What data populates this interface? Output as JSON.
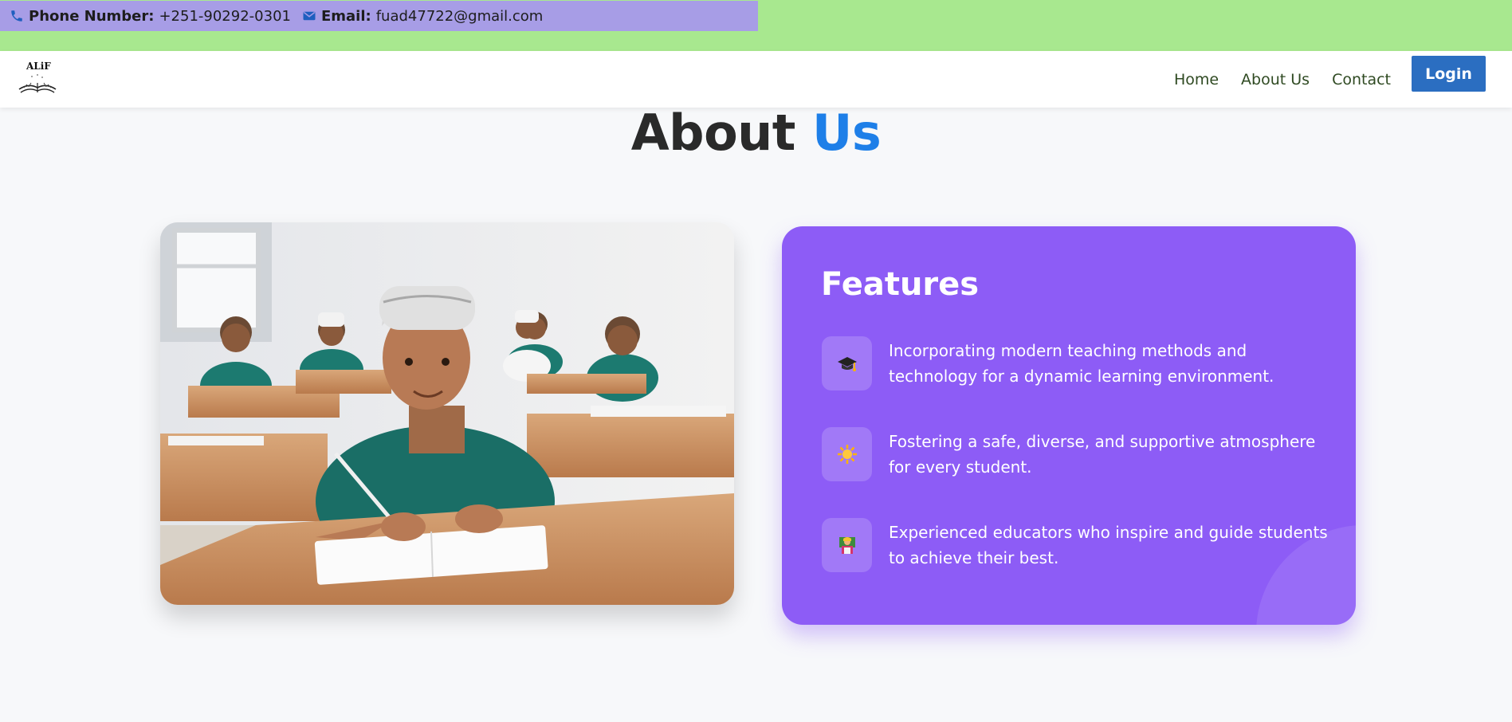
{
  "contact": {
    "phone_label": "Phone Number:",
    "phone_value": "+251-90292-0301",
    "email_label": "Email:",
    "email_value": "fuad47722@gmail.com",
    "phone_icon": "phone-icon",
    "email_icon": "envelope-icon"
  },
  "brand": {
    "logo_text": "ALiF"
  },
  "nav": {
    "items": [
      {
        "label": "Home"
      },
      {
        "label": "About Us"
      },
      {
        "label": "Contact"
      }
    ],
    "login_label": "Login"
  },
  "about": {
    "heading_main": "About",
    "heading_accent": "Us"
  },
  "features": {
    "title": "Features",
    "items": [
      {
        "icon": "graduation-cap-icon",
        "text": "Incorporating modern teaching methods and technology for a dynamic learning environment."
      },
      {
        "icon": "sun-icon",
        "text": "Fostering a safe, diverse, and supportive atmosphere for every student."
      },
      {
        "icon": "teacher-icon",
        "text": "Experienced educators who inspire and guide students to achieve their best."
      }
    ]
  },
  "colors": {
    "topbar_bg": "#a8e88f",
    "contact_bg": "#a79de6",
    "accent_blue": "#1e7fe8",
    "login_bg": "#2b6ec1",
    "features_bg": "#8d5cf6",
    "nav_text": "#2f4a22"
  }
}
